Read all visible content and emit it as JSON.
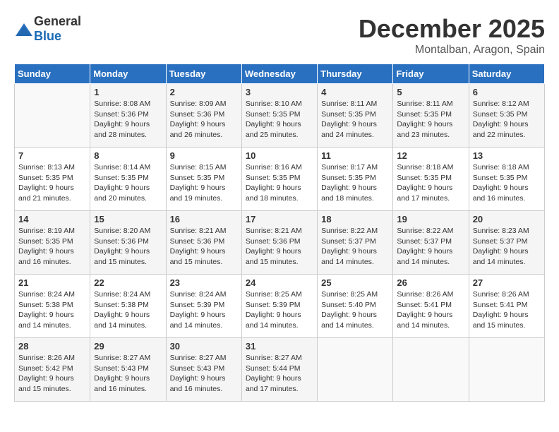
{
  "header": {
    "logo_general": "General",
    "logo_blue": "Blue",
    "month": "December 2025",
    "location": "Montalban, Aragon, Spain"
  },
  "weekdays": [
    "Sunday",
    "Monday",
    "Tuesday",
    "Wednesday",
    "Thursday",
    "Friday",
    "Saturday"
  ],
  "weeks": [
    [
      {
        "day": "",
        "info": ""
      },
      {
        "day": "1",
        "info": "Sunrise: 8:08 AM\nSunset: 5:36 PM\nDaylight: 9 hours\nand 28 minutes."
      },
      {
        "day": "2",
        "info": "Sunrise: 8:09 AM\nSunset: 5:36 PM\nDaylight: 9 hours\nand 26 minutes."
      },
      {
        "day": "3",
        "info": "Sunrise: 8:10 AM\nSunset: 5:35 PM\nDaylight: 9 hours\nand 25 minutes."
      },
      {
        "day": "4",
        "info": "Sunrise: 8:11 AM\nSunset: 5:35 PM\nDaylight: 9 hours\nand 24 minutes."
      },
      {
        "day": "5",
        "info": "Sunrise: 8:11 AM\nSunset: 5:35 PM\nDaylight: 9 hours\nand 23 minutes."
      },
      {
        "day": "6",
        "info": "Sunrise: 8:12 AM\nSunset: 5:35 PM\nDaylight: 9 hours\nand 22 minutes."
      }
    ],
    [
      {
        "day": "7",
        "info": "Sunrise: 8:13 AM\nSunset: 5:35 PM\nDaylight: 9 hours\nand 21 minutes."
      },
      {
        "day": "8",
        "info": "Sunrise: 8:14 AM\nSunset: 5:35 PM\nDaylight: 9 hours\nand 20 minutes."
      },
      {
        "day": "9",
        "info": "Sunrise: 8:15 AM\nSunset: 5:35 PM\nDaylight: 9 hours\nand 19 minutes."
      },
      {
        "day": "10",
        "info": "Sunrise: 8:16 AM\nSunset: 5:35 PM\nDaylight: 9 hours\nand 18 minutes."
      },
      {
        "day": "11",
        "info": "Sunrise: 8:17 AM\nSunset: 5:35 PM\nDaylight: 9 hours\nand 18 minutes."
      },
      {
        "day": "12",
        "info": "Sunrise: 8:18 AM\nSunset: 5:35 PM\nDaylight: 9 hours\nand 17 minutes."
      },
      {
        "day": "13",
        "info": "Sunrise: 8:18 AM\nSunset: 5:35 PM\nDaylight: 9 hours\nand 16 minutes."
      }
    ],
    [
      {
        "day": "14",
        "info": "Sunrise: 8:19 AM\nSunset: 5:35 PM\nDaylight: 9 hours\nand 16 minutes."
      },
      {
        "day": "15",
        "info": "Sunrise: 8:20 AM\nSunset: 5:36 PM\nDaylight: 9 hours\nand 15 minutes."
      },
      {
        "day": "16",
        "info": "Sunrise: 8:21 AM\nSunset: 5:36 PM\nDaylight: 9 hours\nand 15 minutes."
      },
      {
        "day": "17",
        "info": "Sunrise: 8:21 AM\nSunset: 5:36 PM\nDaylight: 9 hours\nand 15 minutes."
      },
      {
        "day": "18",
        "info": "Sunrise: 8:22 AM\nSunset: 5:37 PM\nDaylight: 9 hours\nand 14 minutes."
      },
      {
        "day": "19",
        "info": "Sunrise: 8:22 AM\nSunset: 5:37 PM\nDaylight: 9 hours\nand 14 minutes."
      },
      {
        "day": "20",
        "info": "Sunrise: 8:23 AM\nSunset: 5:37 PM\nDaylight: 9 hours\nand 14 minutes."
      }
    ],
    [
      {
        "day": "21",
        "info": "Sunrise: 8:24 AM\nSunset: 5:38 PM\nDaylight: 9 hours\nand 14 minutes."
      },
      {
        "day": "22",
        "info": "Sunrise: 8:24 AM\nSunset: 5:38 PM\nDaylight: 9 hours\nand 14 minutes."
      },
      {
        "day": "23",
        "info": "Sunrise: 8:24 AM\nSunset: 5:39 PM\nDaylight: 9 hours\nand 14 minutes."
      },
      {
        "day": "24",
        "info": "Sunrise: 8:25 AM\nSunset: 5:39 PM\nDaylight: 9 hours\nand 14 minutes."
      },
      {
        "day": "25",
        "info": "Sunrise: 8:25 AM\nSunset: 5:40 PM\nDaylight: 9 hours\nand 14 minutes."
      },
      {
        "day": "26",
        "info": "Sunrise: 8:26 AM\nSunset: 5:41 PM\nDaylight: 9 hours\nand 14 minutes."
      },
      {
        "day": "27",
        "info": "Sunrise: 8:26 AM\nSunset: 5:41 PM\nDaylight: 9 hours\nand 15 minutes."
      }
    ],
    [
      {
        "day": "28",
        "info": "Sunrise: 8:26 AM\nSunset: 5:42 PM\nDaylight: 9 hours\nand 15 minutes."
      },
      {
        "day": "29",
        "info": "Sunrise: 8:27 AM\nSunset: 5:43 PM\nDaylight: 9 hours\nand 16 minutes."
      },
      {
        "day": "30",
        "info": "Sunrise: 8:27 AM\nSunset: 5:43 PM\nDaylight: 9 hours\nand 16 minutes."
      },
      {
        "day": "31",
        "info": "Sunrise: 8:27 AM\nSunset: 5:44 PM\nDaylight: 9 hours\nand 17 minutes."
      },
      {
        "day": "",
        "info": ""
      },
      {
        "day": "",
        "info": ""
      },
      {
        "day": "",
        "info": ""
      }
    ]
  ]
}
